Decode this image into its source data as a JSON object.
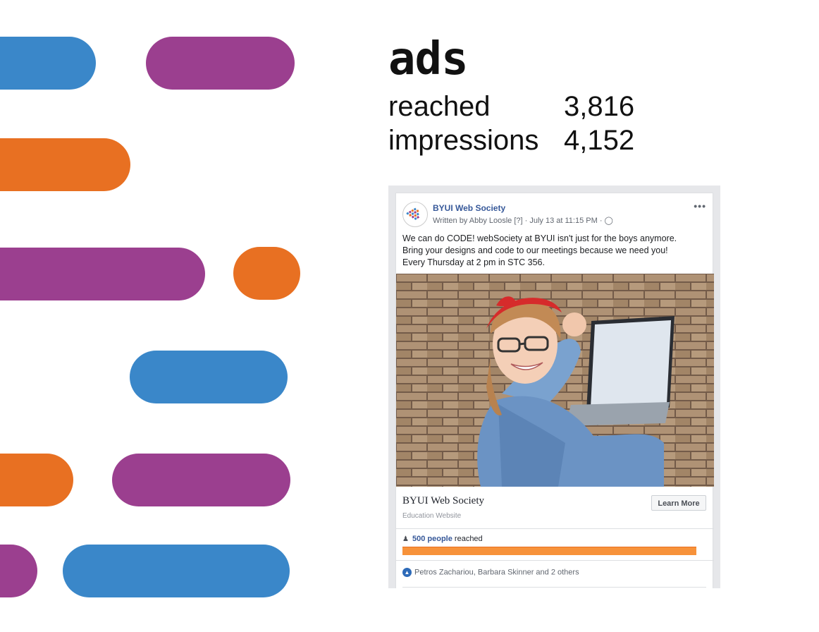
{
  "decoration": {
    "colors": {
      "blue": "#3a87c9",
      "purple": "#9b3f8f",
      "orange": "#e87022"
    }
  },
  "heading": "ads",
  "stats": [
    {
      "label": "reached",
      "value": "3,816"
    },
    {
      "label": "impressions",
      "value": "4,152"
    }
  ],
  "post": {
    "page_name": "BYUI Web Society",
    "byline": "Written by Abby Loosle [?] · July 13 at 11:15 PM · ",
    "privacy_icon": "globe-icon",
    "more_icon": "ellipsis-icon",
    "more_label": "•••",
    "text_lines": [
      "We can do CODE! webSociety at BYUI isn't just for the boys anymore.",
      "Bring your designs and code to our meetings because we need you!",
      "Every Thursday at 2 pm in STC 356."
    ],
    "link_title": "BYUI Web Society",
    "link_subtitle": "Education Website",
    "cta_label": "Learn More",
    "reach": {
      "count_text": "500 people",
      "suffix": " reached",
      "fraction": 1.0
    },
    "reactions_text": "Petros Zachariou, Barbara Skinner and 2 others",
    "reaction_icon": "like-icon"
  }
}
